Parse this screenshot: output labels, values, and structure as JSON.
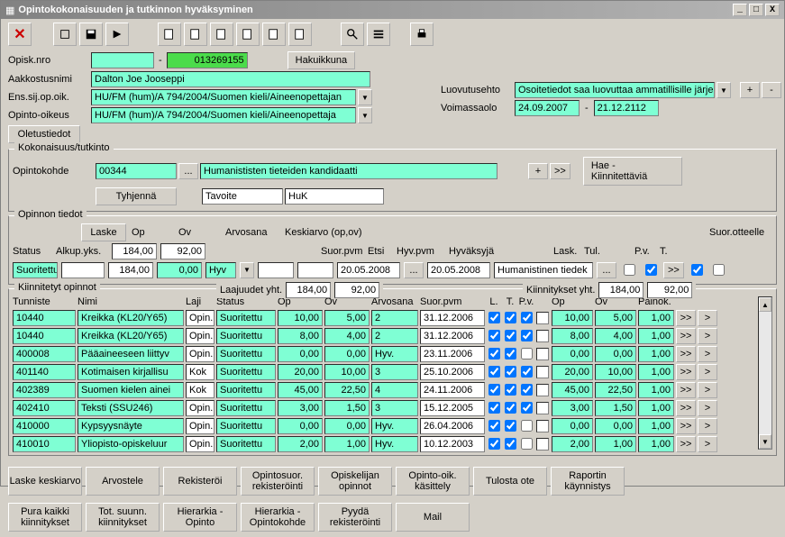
{
  "titlebar": {
    "text": "Opintokokonaisuuden ja tutkinnon hyväksyminen"
  },
  "icons": {
    "close_x": "X",
    "minimize": "_",
    "maximize": "□",
    "win_close": "X"
  },
  "header": {
    "opisk_nro_label": "Opisk.nro",
    "opisk_nro_sep": "-",
    "opisk_nro_val": "013269155",
    "hakuikkuna": "Hakuikkuna",
    "aakkostusnimi_label": "Aakkostusnimi",
    "aakkostusnimi_val": "Dalton Joe Jooseppi",
    "ens_label": "Ens.sij.op.oik.",
    "ens_val": "HU/FM (hum)/A 794/2004/Suomen kieli/Aineenopettajan",
    "opinto_oikeus_label": "Opinto-oikeus",
    "opinto_oikeus_val": "HU/FM (hum)/A 794/2004/Suomen kieli/Aineenopettaja",
    "oletustiedot": "Oletustiedot",
    "luovutusehto_label": "Luovutusehto",
    "luovutusehto_val": "Osoitetiedot saa luovuttaa ammatillisille järje",
    "voimassaolo_label": "Voimassaolo",
    "voimassaolo_from": "24.09.2007",
    "voimassaolo_sep": "-",
    "voimassaolo_to": "21.12.2112",
    "plus": "+",
    "minus": "-"
  },
  "kokonaisuus": {
    "legend": "Kokonaisuus/tutkinto",
    "opintokohde_label": "Opintokohde",
    "opintokohde_code": "00344",
    "opintokohde_name": "Humanististen tieteiden kandidaatti",
    "tyhjenna": "Tyhjennä",
    "tavoite_label": "Tavoite",
    "tavoite_val": "HuK",
    "plus": "+",
    "arrow": ">>",
    "hae": "Hae - Kiinnitettäviä",
    "dots": "..."
  },
  "opinnon": {
    "legend": "Opinnon tiedot",
    "laske": "Laske",
    "status_label": "Status",
    "status_val": "Suoritettu",
    "alkupyks_label": "Alkup.yks.",
    "op_label": "Op",
    "op_val": "184,00",
    "op_val2": "184,00",
    "ov_label": "Ov",
    "ov_val": "92,00",
    "ov_val2": "0,00",
    "arvosana_label": "Arvosana",
    "hyv_val": "Hyv",
    "keskiarvo_label": "Keskiarvo (op,ov)",
    "suorpvm_label": "Suor.pvm",
    "suorpvm_val": "20.05.2008",
    "etsi": "Etsi",
    "hyvpvm_label": "Hyv.pvm",
    "hyvpvm_val": "20.05.2008",
    "hyvaksyja_label": "Hyväksyjä",
    "hyvaksyja_val": "Humanistinen tiedek",
    "suorotteelle_label": "Suor.otteelle",
    "lask_label": "Lask.",
    "tul_label": "Tul.",
    "pv_label": "P.v.",
    "t_label": "T.",
    "dots": "...",
    "arrow": ">>"
  },
  "kiinnitetyt": {
    "legend": "Kiinnitetyt opinnot",
    "laajuudet_label": "Laajuudet yht.",
    "laajuudet_op": "184,00",
    "laajuudet_ov": "92,00",
    "kiinnitykset_label": "Kiinnitykset yht.",
    "kiinnitykset_op": "184,00",
    "kiinnitykset_ov": "92,00",
    "cols": {
      "tunniste": "Tunniste",
      "nimi": "Nimi",
      "laji": "Laji",
      "status": "Status",
      "op": "Op",
      "ov": "Ov",
      "arvosana": "Arvosana",
      "suorpvm": "Suor.pvm",
      "l": "L.",
      "t": "T.",
      "pv": "P.v.",
      "op2": "Op",
      "ov2": "Ov",
      "painok": "Painok."
    },
    "rows": [
      {
        "tunniste": "10440",
        "nimi": "Kreikka (KL20/Y65)",
        "laji": "Opin.",
        "status": "Suoritettu",
        "op": "10,00",
        "ov": "5,00",
        "arvosana": "2",
        "suorpvm": "31.12.2006",
        "l": true,
        "t": true,
        "pv": true,
        "pvw": false,
        "op2": "10,00",
        "ov2": "5,00",
        "painok": "1,00"
      },
      {
        "tunniste": "10440",
        "nimi": "Kreikka (KL20/Y65)",
        "laji": "Opin.",
        "status": "Suoritettu",
        "op": "8,00",
        "ov": "4,00",
        "arvosana": "2",
        "suorpvm": "31.12.2006",
        "l": true,
        "t": true,
        "pv": true,
        "pvw": false,
        "op2": "8,00",
        "ov2": "4,00",
        "painok": "1,00"
      },
      {
        "tunniste": "400008",
        "nimi": "Pääaineeseen liittyv",
        "laji": "Opin.",
        "status": "Suoritettu",
        "op": "0,00",
        "ov": "0,00",
        "arvosana": "Hyv.",
        "suorpvm": "23.11.2006",
        "l": true,
        "t": true,
        "pv": false,
        "pvw": false,
        "op2": "0,00",
        "ov2": "0,00",
        "painok": "1,00"
      },
      {
        "tunniste": "401140",
        "nimi": "Kotimaisen kirjallisu",
        "laji": "Kok",
        "status": "Suoritettu",
        "op": "20,00",
        "ov": "10,00",
        "arvosana": "3",
        "suorpvm": "25.10.2006",
        "l": true,
        "t": true,
        "pv": true,
        "pvw": false,
        "op2": "20,00",
        "ov2": "10,00",
        "painok": "1,00"
      },
      {
        "tunniste": "402389",
        "nimi": "Suomen kielen ainei",
        "laji": "Kok",
        "status": "Suoritettu",
        "op": "45,00",
        "ov": "22,50",
        "arvosana": "4",
        "suorpvm": "24.11.2006",
        "l": true,
        "t": true,
        "pv": true,
        "pvw": false,
        "op2": "45,00",
        "ov2": "22,50",
        "painok": "1,00"
      },
      {
        "tunniste": "402410",
        "nimi": "Teksti (SSU246)",
        "laji": "Opin.",
        "status": "Suoritettu",
        "op": "3,00",
        "ov": "1,50",
        "arvosana": "3",
        "suorpvm": "15.12.2005",
        "l": true,
        "t": true,
        "pv": true,
        "pvw": false,
        "op2": "3,00",
        "ov2": "1,50",
        "painok": "1,00"
      },
      {
        "tunniste": "410000",
        "nimi": "Kypsyysnäyte",
        "laji": "Opin.",
        "status": "Suoritettu",
        "op": "0,00",
        "ov": "0,00",
        "arvosana": "Hyv.",
        "suorpvm": "26.04.2006",
        "l": true,
        "t": true,
        "pv": false,
        "pvw": false,
        "op2": "0,00",
        "ov2": "0,00",
        "painok": "1,00"
      },
      {
        "tunniste": "410010",
        "nimi": "Yliopisto-opiskeluur",
        "laji": "Opin.",
        "status": "Suoritettu",
        "op": "2,00",
        "ov": "1,00",
        "arvosana": "Hyv.",
        "suorpvm": "10.12.2003",
        "l": true,
        "t": true,
        "pv": false,
        "pvw": false,
        "op2": "2,00",
        "ov2": "1,00",
        "painok": "1,00"
      }
    ],
    "arrow": ">>",
    "arrow2": ">"
  },
  "buttons": {
    "b1": "Laske keskiarvo",
    "b2": "Arvostele",
    "b3": "Rekisteröi",
    "b4": "Opintosuor. rekisteröinti",
    "b5": "Opiskelijan opinnot",
    "b6": "Opinto-oik. käsittely",
    "b7": "Tulosta ote",
    "b8": "Raportin käynnistys",
    "b9": "Pura kaikki kiinnitykset",
    "b10": "Tot. suunn. kiinnitykset",
    "b11": "Hierarkia - Opinto",
    "b12": "Hierarkia - Opintokohde",
    "b13": "Pyydä rekisteröinti",
    "b14": "Mail"
  }
}
